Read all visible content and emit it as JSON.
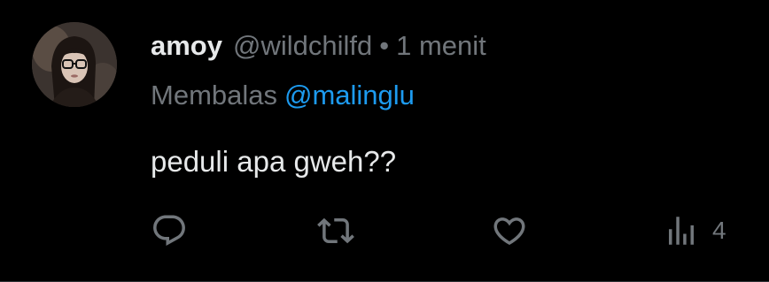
{
  "tweet": {
    "author_name": "amoy",
    "author_handle": "@wildchilfd",
    "separator": "•",
    "time": "1 menit",
    "reply_prefix": "Membalas",
    "reply_mention": "@malinglu",
    "text": "peduli apa gweh??",
    "avatar_icon": "profile-photo"
  },
  "actions": {
    "reply_icon": "reply-icon",
    "repost_icon": "repost-icon",
    "like_icon": "heart-icon",
    "views_icon": "views-chart-icon",
    "views_count": "4"
  },
  "colors": {
    "background": "#000000",
    "primary_text": "#e7e9ea",
    "secondary_text": "#71767b",
    "accent": "#1d9bf0"
  }
}
